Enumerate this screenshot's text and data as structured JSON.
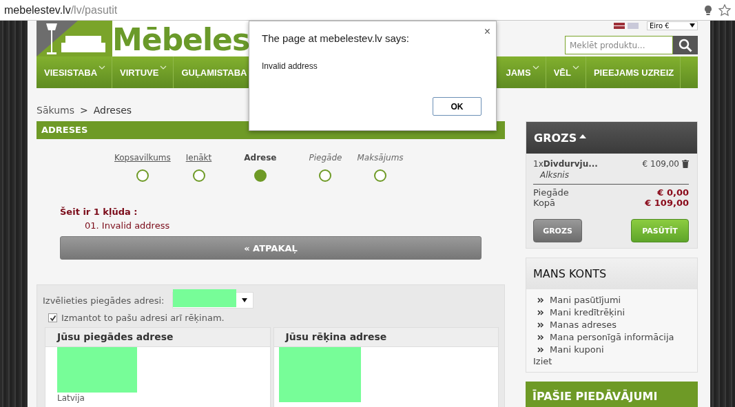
{
  "browser": {
    "url_host": "mebelestev.lv",
    "url_path": "/lv/pasutit"
  },
  "header": {
    "logo_text": "Mēbeles",
    "currency": "Eiro €",
    "search_placeholder": "Meklēt produktu..."
  },
  "nav": [
    {
      "label": "VIESISTABA",
      "caret": true
    },
    {
      "label": "VIRTUVE",
      "caret": true
    },
    {
      "label": "GUĻAMISTABA",
      "caret": false
    },
    {
      "label": "JAMS",
      "caret": true
    },
    {
      "label": "VĒL",
      "caret": true
    },
    {
      "label": "PIEEJAMS UZREIZ",
      "caret": false
    }
  ],
  "breadcrumb": {
    "home": "Sākums",
    "separator": ">",
    "current": "Adreses"
  },
  "section_title": "ADRESES",
  "steps": [
    {
      "label": "Kopsavilkums",
      "kind": "done",
      "selected": false
    },
    {
      "label": "Ienākt",
      "kind": "done",
      "selected": false
    },
    {
      "label": "Adrese",
      "kind": "current",
      "selected": true
    },
    {
      "label": "Piegāde",
      "kind": "todo",
      "selected": false
    },
    {
      "label": "Maksājums",
      "kind": "todo",
      "selected": false
    }
  ],
  "errors": {
    "title": "Šeit ir 1 kļūda :",
    "items": [
      "01. Invalid address"
    ]
  },
  "back_button": "« ATPAKAĻ",
  "address_form": {
    "select_label": "Izvēlieties piegādes adresi:",
    "same_address": {
      "label": "Izmantot to pašu adresi arī rēķinam.",
      "checked": true
    },
    "delivery_title": "Jūsu piegādes adrese",
    "delivery_country": "Latvija",
    "billing_title": "Jūsu rēķina adrese"
  },
  "cart": {
    "title": "GROZS",
    "item_qty": "1x",
    "item_name": "Divdurvju...",
    "item_price": "€ 109,00",
    "item_variant": "Alksnis",
    "shipping_label": "Piegāde",
    "shipping_value": "€ 0,00",
    "total_label": "Kopā",
    "total_value": "€ 109,00",
    "cart_button": "GROZS",
    "order_button": "PASŪTĪT"
  },
  "account": {
    "title": "MANS KONTS",
    "links": [
      "Mani pasūtījumi",
      "Mani kredītrēķini",
      "Manas adreses",
      "Mana personīgā informācija",
      "Mani kuponi"
    ],
    "logout": "Iziet"
  },
  "specials_title": "ĪPAŠIE PIEDĀVĀJUMI",
  "dialog": {
    "title": "The page at mebelestev.lv says:",
    "message": "Invalid address",
    "close": "×",
    "ok": "OK"
  }
}
